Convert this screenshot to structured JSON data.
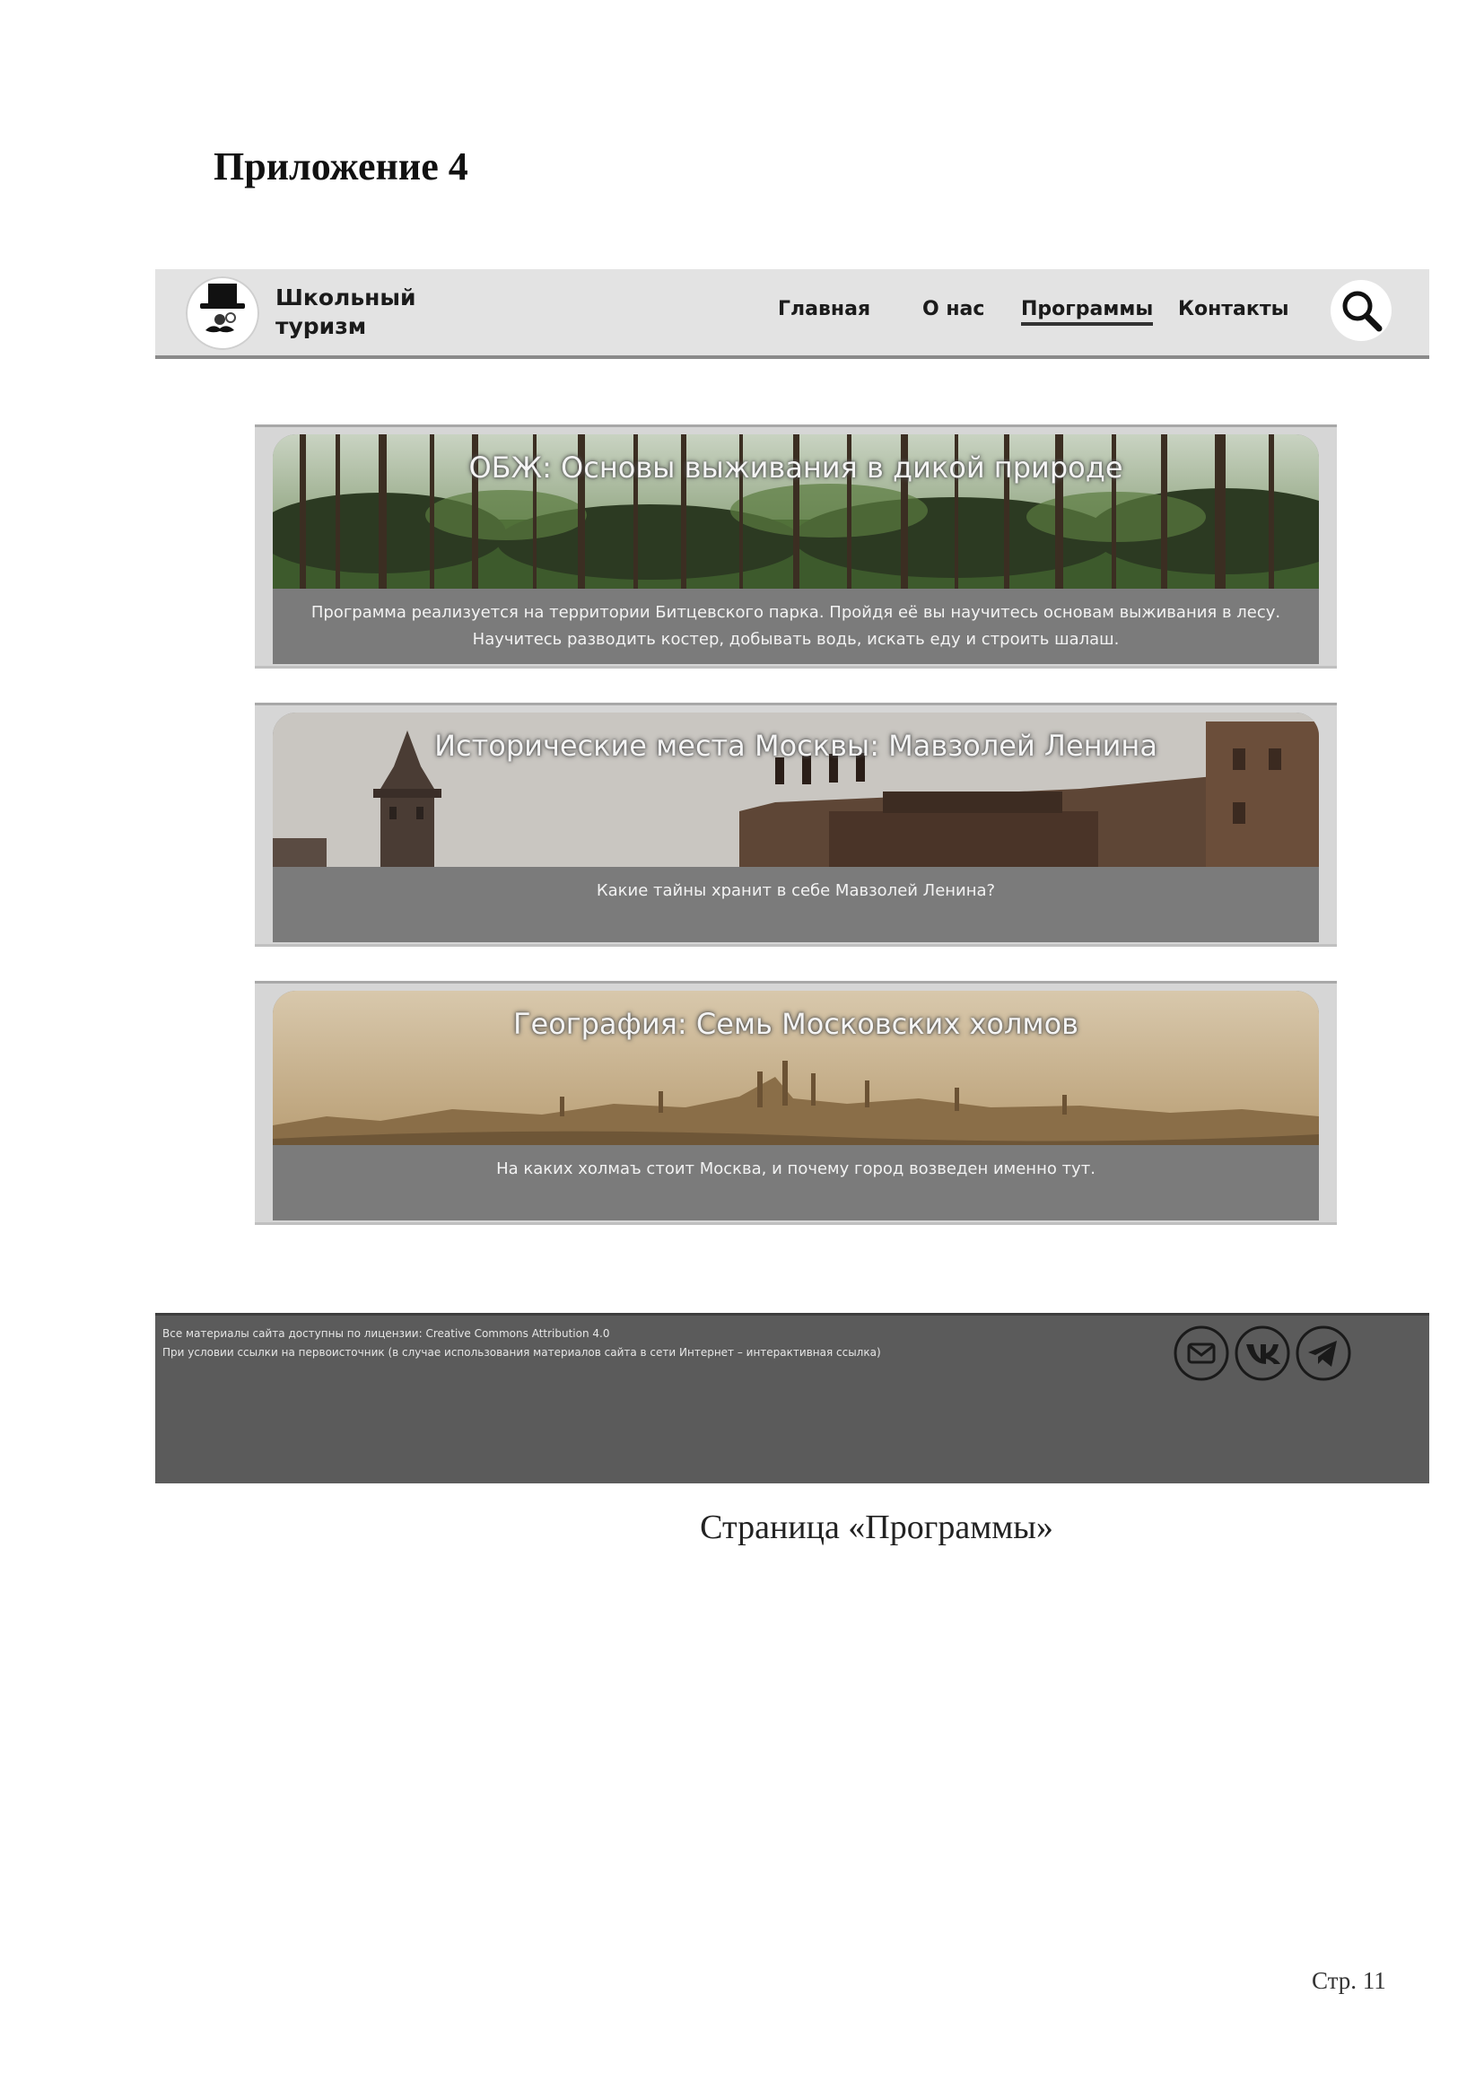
{
  "document": {
    "appendix_title": "Приложение 4",
    "caption": "Страница «Программы»",
    "page_number": "Стр. 11"
  },
  "header": {
    "logo_icon": "top-hat-mustache-logo",
    "brand_line1": "Школьный",
    "brand_line2": "туризм",
    "nav": [
      {
        "label": "Главная",
        "active": false
      },
      {
        "label": "О нас",
        "active": false
      },
      {
        "label": "Программы",
        "active": true
      },
      {
        "label": "Контакты",
        "active": false
      }
    ],
    "search_icon": "search-icon"
  },
  "programs": [
    {
      "title": "ОБЖ: Основы выживания в дикой природе",
      "description": [
        "Программа реализуется на территории Битцевского парка. Пройдя её вы научитесь основам выживания в лесу.",
        "Научитесь разводить костер, добывать водь, искать еду и строить шалаш."
      ],
      "image": "forest"
    },
    {
      "title": "Исторические места Москвы: Мавзолей Ленина",
      "description": [
        "Какие тайны хранит в себе Мавзолей Ленина?"
      ],
      "image": "red-square"
    },
    {
      "title": "География: Семь Московских холмов",
      "description": [
        "На каких холмаъ стоит Москва, и почему город возведен именно тут."
      ],
      "image": "moscow-panorama"
    }
  ],
  "footer": {
    "line1": "Все материалы сайта доступны по лицензии: Creative Commons Attribution 4.0",
    "line2": "При условии ссылки на первоисточник (в случае использования материалов сайта в сети Интернет – интерактивная ссылка)",
    "socials": [
      "mail-icon",
      "vk-icon",
      "telegram-icon"
    ]
  },
  "colors": {
    "header_bg": "#e3e3e3",
    "card_bg": "#d6d6d6",
    "card_desc_bg": "#7b7b7b",
    "footer_bg": "#5b5b5b"
  }
}
